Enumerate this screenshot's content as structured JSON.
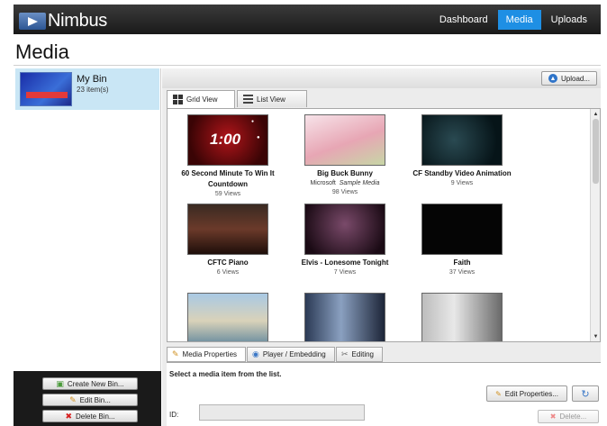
{
  "app": {
    "name": "Nimbus"
  },
  "nav": [
    {
      "label": "Dashboard",
      "active": false
    },
    {
      "label": "Media",
      "active": true
    },
    {
      "label": "Uploads",
      "active": false
    }
  ],
  "page": {
    "title": "Media"
  },
  "bins": [
    {
      "name": "My Bin",
      "count": "23 item(s)"
    }
  ],
  "bin_actions": {
    "create": "Create New Bin...",
    "edit": "Edit Bin...",
    "delete": "Delete Bin..."
  },
  "toolbar": {
    "upload": "Upload..."
  },
  "view_tabs": {
    "grid": "Grid View",
    "list": "List View"
  },
  "media": [
    {
      "title": "60 Second Minute To Win It Countdown",
      "views": "59 Views"
    },
    {
      "title": "Big Buck Bunny",
      "publisher": "Microsoft",
      "tag": "Sample Media",
      "views": "98 Views"
    },
    {
      "title": "CF Standby Video Animation",
      "views": "9 Views"
    },
    {
      "title": "CFTC Piano",
      "views": "6 Views"
    },
    {
      "title": "Elvis - Lonesome Tonight",
      "views": "7 Views"
    },
    {
      "title": "Faith",
      "views": "37 Views"
    },
    {
      "title": "",
      "views": ""
    },
    {
      "title": "",
      "views": ""
    },
    {
      "title": "",
      "views": ""
    }
  ],
  "prop_tabs": {
    "properties": "Media Properties",
    "player": "Player / Embedding",
    "editing": "Editing"
  },
  "properties": {
    "message": "Select a media item from the list.",
    "edit_button": "Edit Properties...",
    "id_label": "ID:",
    "id_value": "",
    "delete_button": "Delete..."
  },
  "colors": {
    "accent": "#1e8fe4",
    "topbar": "#1f1f1f",
    "selected_bin": "#c9e6f5"
  }
}
